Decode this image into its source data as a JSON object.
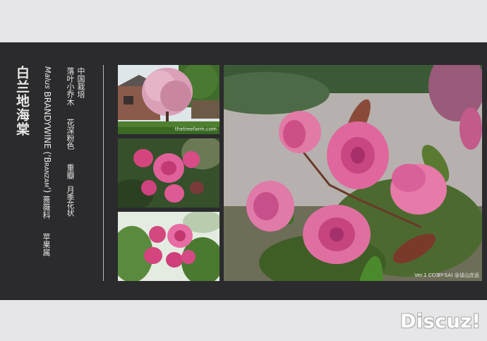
{
  "title": "白兰地海棠",
  "latin_name": {
    "genus": "Malus",
    "cultivar": "BRANDYWINE ('Branzam')"
  },
  "family": "蔷薇科",
  "genus_cn": "苹果属",
  "origin": "中国栽培",
  "habit": "落叶小乔木",
  "flower_color": "花深粉色",
  "petal_type": "重瓣",
  "flower_form": "月季花状",
  "photo_credit_small": "thetreefarm.com",
  "photo_credit_main": "Ver.1 CC(BY-SA) @谈山庄远",
  "watermark": "Discuz!"
}
